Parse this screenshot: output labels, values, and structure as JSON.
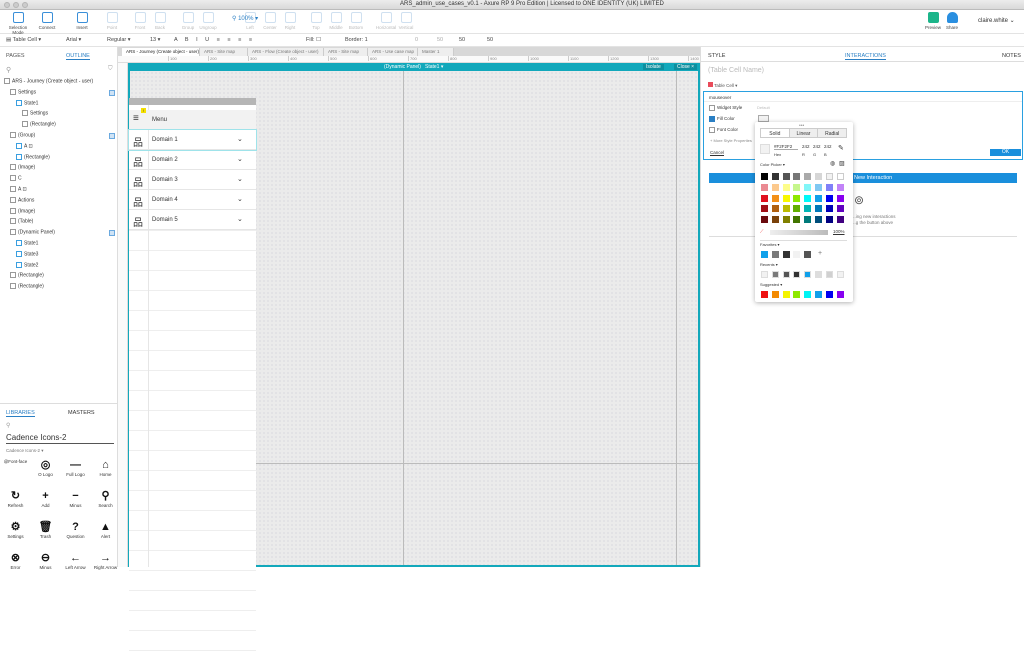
{
  "window": {
    "title": "ARS_admin_use_cases_v0.1 - Axure RP 9 Pro Edition | Licensed to ONE IDENTITY (UK) LIMITED"
  },
  "toolbar": {
    "items": [
      "Selection Mode",
      "Connect",
      "Insert",
      "Point",
      "Front",
      "Back",
      "Group",
      "Ungroup",
      "Left",
      "Center",
      "Right",
      "Top",
      "Middle",
      "Bottom",
      "Horizontal",
      "Vertical"
    ],
    "zoom": "100%",
    "preview": "Preview",
    "share": "Share",
    "user": "claire.white"
  },
  "format": {
    "widget": "Table Cell",
    "font": "Arial",
    "weight": "Regular",
    "size": "13",
    "fill_label": "Fill:",
    "border_label": "Border:",
    "border_value": "1",
    "x": "0",
    "y": "50",
    "w": "50",
    "h": "50"
  },
  "left": {
    "tabs": [
      "PAGES",
      "OUTLINE"
    ],
    "tree": [
      {
        "label": "ARS - Journey (Create object - user)",
        "indent": 0
      },
      {
        "label": "Settings",
        "indent": 1,
        "flag": true
      },
      {
        "label": "State1",
        "indent": 2
      },
      {
        "label": "Settings",
        "indent": 3
      },
      {
        "label": "(Rectangle)",
        "indent": 3
      },
      {
        "label": "(Group)",
        "indent": 1,
        "flag": true
      },
      {
        "label": "A ⊡",
        "indent": 2
      },
      {
        "label": "(Rectangle)",
        "indent": 2
      },
      {
        "label": "(Image)",
        "indent": 1
      },
      {
        "label": "C",
        "indent": 1
      },
      {
        "label": "A ⊡",
        "indent": 1
      },
      {
        "label": "Actions",
        "indent": 1
      },
      {
        "label": "(Image)",
        "indent": 1
      },
      {
        "label": "(Table)",
        "indent": 1
      },
      {
        "label": "(Dynamic Panel)",
        "indent": 1,
        "flag": true
      },
      {
        "label": "State1",
        "indent": 2
      },
      {
        "label": "State3",
        "indent": 2
      },
      {
        "label": "State2",
        "indent": 2
      },
      {
        "label": "(Rectangle)",
        "indent": 1
      },
      {
        "label": "(Rectangle)",
        "indent": 1
      }
    ]
  },
  "libraries": {
    "tabs": [
      "LIBRARIES",
      "MASTERS"
    ],
    "selected": "Cadence Icons-2",
    "sub": "Cadence Icons-2 ▾",
    "icons": [
      {
        "g": "",
        "l": "@Font-face"
      },
      {
        "g": "◎",
        "l": "O Logo"
      },
      {
        "g": "—",
        "l": "Full Logo"
      },
      {
        "g": "⌂",
        "l": "Home"
      },
      {
        "g": "↻",
        "l": "Refresh"
      },
      {
        "g": "+",
        "l": "Add"
      },
      {
        "g": "−",
        "l": "Minus"
      },
      {
        "g": "⚲",
        "l": "Search"
      },
      {
        "g": "⚙",
        "l": "Settings"
      },
      {
        "g": "🗑",
        "l": "Trash"
      },
      {
        "g": "?",
        "l": "Question"
      },
      {
        "g": "▲",
        "l": "Alert"
      },
      {
        "g": "⊗",
        "l": "Error"
      },
      {
        "g": "⊖",
        "l": "Minus"
      },
      {
        "g": "←",
        "l": "Left Arrow"
      },
      {
        "g": "→",
        "l": "Right Arrow"
      }
    ]
  },
  "doc_tabs": [
    "ARS - Journey (Create object - user)",
    "ARS - Site map",
    "ARS - Flow (Create object - user)",
    "ARS - Site map",
    "ARS - Use case map",
    "Master 1"
  ],
  "ruler": [
    "100",
    "200",
    "300",
    "400",
    "500",
    "600",
    "700",
    "800",
    "900",
    "1000",
    "1100",
    "1200",
    "1300",
    "1400"
  ],
  "panel_header": {
    "name": "(Dynamic Panel)",
    "state": "State1 ▾",
    "isolate": "Isolate",
    "close": "Close ×"
  },
  "menu": {
    "title": "Menu",
    "items": [
      "Domain 1",
      "Domain 2",
      "Domain 3",
      "Domain 4",
      "Domain 5"
    ]
  },
  "right": {
    "tabs": [
      "STYLE",
      "INTERACTIONS",
      "NOTES"
    ],
    "name_placeholder": "(Table Cell Name)",
    "widget": "Table Cell ▾",
    "event": "mouseover",
    "widget_style": "Widget Style",
    "widget_style_value": "Default",
    "fill_color": "Fill Color",
    "font_color": "Font Color",
    "more": "+ More Style Properties",
    "cancel": "Cancel",
    "ok": "OK",
    "new_interaction": "New Interaction",
    "hint1": "...ing new interactions",
    "hint2": "...g the button above"
  },
  "picker": {
    "modes": [
      "Solid",
      "Linear",
      "Radial"
    ],
    "hex": "#F2F2F2",
    "hex_label": "Hex",
    "r": "242",
    "g": "242",
    "b": "242",
    "rl": "R",
    "gl": "G",
    "bl": "B",
    "label": "Color Picker ▾",
    "opacity": "100%",
    "favorites": "Favorites ▾",
    "recents": "Recents ▾",
    "suggested": "Suggested ▾",
    "grid": [
      "#000000",
      "#333333",
      "#555555",
      "#777777",
      "#aaaaaa",
      "#d6d6d6",
      "#f2f2f2",
      "#ffffff",
      "#ea8a92",
      "#fcc98d",
      "#fdfd8a",
      "#c6f68c",
      "#82f6f8",
      "#80c8f2",
      "#8080f8",
      "#c283f8",
      "#e0101e",
      "#f39016",
      "#f8f800",
      "#8fe800",
      "#00f8f8",
      "#10a0ea",
      "#0000f0",
      "#8800f0",
      "#a00f17",
      "#b0600f",
      "#bcbc00",
      "#62b000",
      "#00b6b6",
      "#0078b8",
      "#0000b8",
      "#6000c0",
      "#6a0a0e",
      "#7a420a",
      "#808000",
      "#427500",
      "#007a7a",
      "#004e7a",
      "#000080",
      "#400080"
    ],
    "fav": [
      "#10a0ea",
      "#7a7a7a",
      "#333333",
      "#f2f2f2",
      "#555555"
    ],
    "recent": [
      "#f2f2f2",
      "#7a7a7a",
      "#555555",
      "#333333",
      "#10a0ea",
      "#dddddd",
      "#d0d0d0",
      "#f2f2f2"
    ],
    "sugg": [
      "#ee1111",
      "#f38a00",
      "#f4f400",
      "#8fe800",
      "#00f4f4",
      "#10a0ea",
      "#0000f0",
      "#8800f0"
    ]
  }
}
